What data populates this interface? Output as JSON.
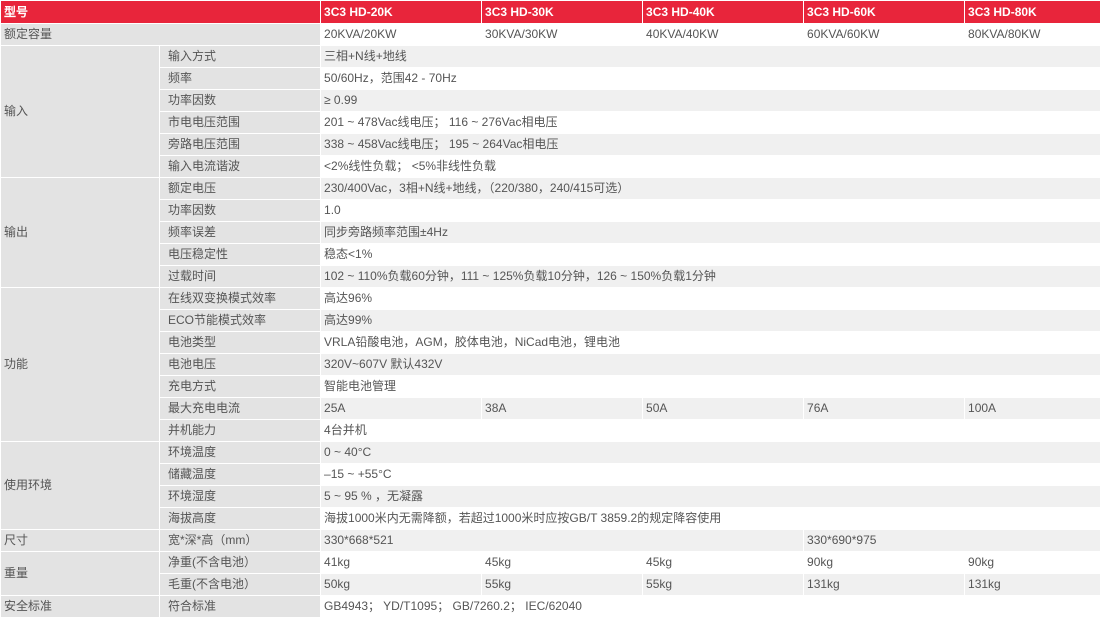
{
  "header": {
    "label": "型号",
    "models": [
      "3C3 HD-20K",
      "3C3 HD-30K",
      "3C3 HD-40K",
      "3C3 HD-60K",
      "3C3 HD-80K"
    ]
  },
  "rated_capacity": {
    "label": "额定容量",
    "values": [
      "20KVA/20KW",
      "30KVA/30KW",
      "40KVA/40KW",
      "60KVA/60KW",
      "80KVA/80KW"
    ]
  },
  "input": {
    "label": "输入",
    "rows": [
      {
        "label": "输入方式",
        "value": "三相+N线+地线"
      },
      {
        "label": "频率",
        "value": "50/60Hz，范围42 - 70Hz"
      },
      {
        "label": "功率因数",
        "value": "≥ 0.99"
      },
      {
        "label": "市电电压范围",
        "value": "201 ~ 478Vac线电压； 116 ~ 276Vac相电压"
      },
      {
        "label": "旁路电压范围",
        "value": "338 ~ 458Vac线电压； 195 ~ 264Vac相电压"
      },
      {
        "label": "输入电流谐波",
        "value": "<2%线性负载； <5%非线性负载"
      }
    ]
  },
  "output": {
    "label": "输出",
    "rows": [
      {
        "label": "额定电压",
        "value": "230/400Vac，3相+N线+地线，（220/380，240/415可选）"
      },
      {
        "label": "功率因数",
        "value": "1.0"
      },
      {
        "label": "频率误差",
        "value": "同步旁路频率范围±4Hz"
      },
      {
        "label": "电压稳定性",
        "value": "稳态<1%"
      },
      {
        "label": "过载时间",
        "value": "102 ~ 110%负载60分钟，111 ~ 125%负载10分钟，126 ~ 150%负载1分钟"
      }
    ]
  },
  "function": {
    "label": "功能",
    "rows": [
      {
        "label": "在线双变换模式效率",
        "value": "高达96%"
      },
      {
        "label": "ECO节能模式效率",
        "value": "高达99%"
      },
      {
        "label": "电池类型",
        "value": "VRLA铅酸电池，AGM，胶体电池，NiCad电池，锂电池"
      },
      {
        "label": "电池电压",
        "value": "320V~607V 默认432V"
      },
      {
        "label": "充电方式",
        "value": "智能电池管理"
      }
    ],
    "max_charge": {
      "label": "最大充电电流",
      "values": [
        "25A",
        "38A",
        "50A",
        "76A",
        "100A"
      ]
    },
    "parallel": {
      "label": "并机能力",
      "value": "4台并机"
    }
  },
  "environment": {
    "label": "使用环境",
    "rows": [
      {
        "label": "环境温度",
        "value": "0 ~ 40°C"
      },
      {
        "label": "储藏温度",
        "value": "–15 ~ +55°C"
      },
      {
        "label": "环境湿度",
        "value": "5 ~ 95 % ，无凝露"
      },
      {
        "label": "海拔高度",
        "value": "海拔1000米内无需降额，若超过1000米时应按GB/T 3859.2的规定降容使用"
      }
    ]
  },
  "dimension": {
    "label": "尺寸",
    "sub": "宽*深*高（mm）",
    "value_a": "330*668*521",
    "value_b": "330*690*975"
  },
  "weight": {
    "label": "重量",
    "net": {
      "label": "净重(不含电池）",
      "values": [
        "41kg",
        "45kg",
        "45kg",
        "90kg",
        "90kg"
      ]
    },
    "gross": {
      "label": "毛重(不含电池）",
      "values": [
        "50kg",
        "55kg",
        "55kg",
        "131kg",
        "131kg"
      ]
    }
  },
  "safety": {
    "label": "安全标准",
    "sub": "符合标准",
    "value": "GB4943； YD/T1095； GB/7260.2； IEC/62040"
  }
}
